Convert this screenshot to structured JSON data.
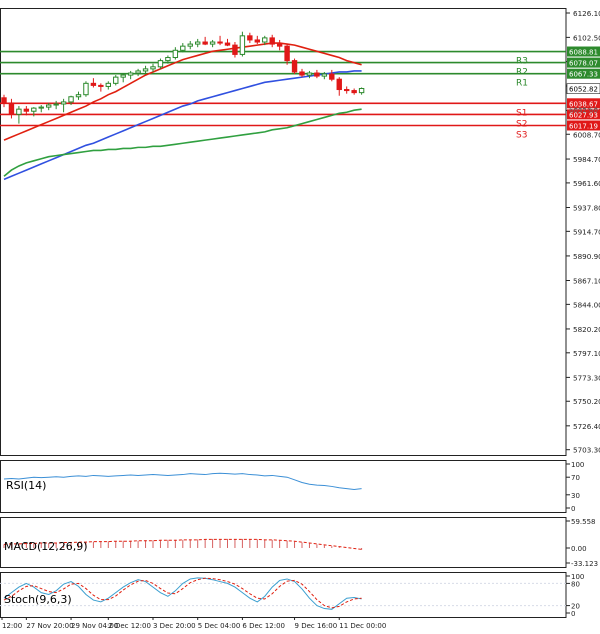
{
  "chart_data": {
    "type": "candlestick",
    "main": {
      "ylim": [
        5703.0,
        6126.1
      ],
      "y_ticks": [
        6126.1,
        6102.5,
        6079.0,
        6055.4,
        6031.8,
        6008.7,
        5984.7,
        5961.6,
        5937.8,
        5914.7,
        5890.9,
        5867.1,
        5844.0,
        5820.2,
        5797.1,
        5773.3,
        5750.2,
        5726.4,
        5703.3
      ],
      "y_tick_labels": [
        "6126.10",
        "6102.50",
        "6079.00",
        "6055.40",
        "6031.80",
        "6008.70",
        "5984.70",
        "5961.60",
        "5937.80",
        "5914.70",
        "5890.90",
        "5867.10",
        "5844.00",
        "5820.20",
        "5797.10",
        "5773.30",
        "5750.20",
        "5726.40",
        "5703.30"
      ],
      "candles": [
        {
          "o": 6044,
          "h": 6047,
          "l": 6035,
          "c": 6039
        },
        {
          "o": 6039,
          "h": 6043,
          "l": 6024,
          "c": 6028
        },
        {
          "o": 6028,
          "h": 6036,
          "l": 6019,
          "c": 6033
        },
        {
          "o": 6033,
          "h": 6036,
          "l": 6027,
          "c": 6031
        },
        {
          "o": 6031,
          "h": 6035,
          "l": 6026,
          "c": 6034
        },
        {
          "o": 6034,
          "h": 6037,
          "l": 6030,
          "c": 6035
        },
        {
          "o": 6035,
          "h": 6039,
          "l": 6032,
          "c": 6037
        },
        {
          "o": 6037,
          "h": 6041,
          "l": 6033,
          "c": 6038
        },
        {
          "o": 6038,
          "h": 6043,
          "l": 6030,
          "c": 6040
        },
        {
          "o": 6040,
          "h": 6046,
          "l": 6037,
          "c": 6045
        },
        {
          "o": 6045,
          "h": 6050,
          "l": 6042,
          "c": 6047
        },
        {
          "o": 6047,
          "h": 6060,
          "l": 6045,
          "c": 6058
        },
        {
          "o": 6058,
          "h": 6063,
          "l": 6054,
          "c": 6056
        },
        {
          "o": 6056,
          "h": 6058,
          "l": 6050,
          "c": 6055
        },
        {
          "o": 6055,
          "h": 6060,
          "l": 6052,
          "c": 6058
        },
        {
          "o": 6058,
          "h": 6066,
          "l": 6056,
          "c": 6064
        },
        {
          "o": 6064,
          "h": 6068,
          "l": 6059,
          "c": 6066
        },
        {
          "o": 6066,
          "h": 6070,
          "l": 6062,
          "c": 6068
        },
        {
          "o": 6068,
          "h": 6072,
          "l": 6065,
          "c": 6070
        },
        {
          "o": 6070,
          "h": 6075,
          "l": 6067,
          "c": 6072
        },
        {
          "o": 6072,
          "h": 6077,
          "l": 6069,
          "c": 6074
        },
        {
          "o": 6074,
          "h": 6082,
          "l": 6072,
          "c": 6080
        },
        {
          "o": 6080,
          "h": 6085,
          "l": 6077,
          "c": 6083
        },
        {
          "o": 6083,
          "h": 6093,
          "l": 6081,
          "c": 6090
        },
        {
          "o": 6090,
          "h": 6097,
          "l": 6088,
          "c": 6094
        },
        {
          "o": 6094,
          "h": 6099,
          "l": 6091,
          "c": 6096
        },
        {
          "o": 6096,
          "h": 6101,
          "l": 6093,
          "c": 6098
        },
        {
          "o": 6098,
          "h": 6103,
          "l": 6095,
          "c": 6096
        },
        {
          "o": 6096,
          "h": 6100,
          "l": 6093,
          "c": 6098
        },
        {
          "o": 6098,
          "h": 6104,
          "l": 6095,
          "c": 6097
        },
        {
          "o": 6097,
          "h": 6101,
          "l": 6094,
          "c": 6095
        },
        {
          "o": 6095,
          "h": 6098,
          "l": 6083,
          "c": 6086
        },
        {
          "o": 6086,
          "h": 6108,
          "l": 6084,
          "c": 6104
        },
        {
          "o": 6104,
          "h": 6107,
          "l": 6097,
          "c": 6100
        },
        {
          "o": 6100,
          "h": 6104,
          "l": 6096,
          "c": 6098
        },
        {
          "o": 6098,
          "h": 6104,
          "l": 6095,
          "c": 6102
        },
        {
          "o": 6102,
          "h": 6105,
          "l": 6093,
          "c": 6096
        },
        {
          "o": 6096,
          "h": 6100,
          "l": 6090,
          "c": 6094
        },
        {
          "o": 6094,
          "h": 6096,
          "l": 6076,
          "c": 6080
        },
        {
          "o": 6080,
          "h": 6082,
          "l": 6067,
          "c": 6069
        },
        {
          "o": 6069,
          "h": 6072,
          "l": 6064,
          "c": 6066
        },
        {
          "o": 6066,
          "h": 6070,
          "l": 6063,
          "c": 6068
        },
        {
          "o": 6068,
          "h": 6071,
          "l": 6063,
          "c": 6065
        },
        {
          "o": 6065,
          "h": 6069,
          "l": 6062,
          "c": 6067
        },
        {
          "o": 6067,
          "h": 6071,
          "l": 6060,
          "c": 6062
        },
        {
          "o": 6062,
          "h": 6064,
          "l": 6046,
          "c": 6052
        },
        {
          "o": 6052,
          "h": 6055,
          "l": 6048,
          "c": 6051
        },
        {
          "o": 6051,
          "h": 6053,
          "l": 6047,
          "c": 6049
        },
        {
          "o": 6049,
          "h": 6054,
          "l": 6047,
          "c": 6053
        }
      ],
      "moving_averages": [
        {
          "color": "#e02010",
          "values": [
            6003,
            6006,
            6009,
            6012,
            6015,
            6018,
            6021,
            6024,
            6027,
            6030,
            6033,
            6036,
            6040,
            6043,
            6047,
            6050,
            6054,
            6058,
            6062,
            6066,
            6069,
            6072,
            6075,
            6078,
            6081,
            6083,
            6085,
            6087,
            6089,
            6090,
            6091,
            6092,
            6093,
            6094,
            6095,
            6096,
            6097,
            6097,
            6096,
            6095,
            6093,
            6091,
            6089,
            6087,
            6085,
            6083,
            6080,
            6078,
            6076
          ]
        },
        {
          "color": "#3050e0",
          "values": [
            5965,
            5968,
            5971,
            5974,
            5977,
            5980,
            5983,
            5986,
            5989,
            5992,
            5995,
            5998,
            6000,
            6003,
            6006,
            6009,
            6012,
            6015,
            6018,
            6021,
            6024,
            6027,
            6030,
            6033,
            6036,
            6038,
            6041,
            6043,
            6045,
            6047,
            6049,
            6051,
            6053,
            6055,
            6057,
            6059,
            6060,
            6061,
            6062,
            6063,
            6064,
            6065,
            6066,
            6067,
            6068,
            6069,
            6069,
            6070,
            6070
          ]
        },
        {
          "color": "#30a040",
          "values": [
            5968,
            5974,
            5978,
            5981,
            5983,
            5985,
            5987,
            5988,
            5989,
            5990,
            5991,
            5992,
            5993,
            5993,
            5994,
            5994,
            5995,
            5995,
            5996,
            5996,
            5997,
            5997,
            5998,
            5999,
            6000,
            6001,
            6002,
            6003,
            6004,
            6005,
            6006,
            6007,
            6008,
            6009,
            6010,
            6011,
            6013,
            6014,
            6015,
            6017,
            6019,
            6021,
            6023,
            6025,
            6027,
            6029,
            6030,
            6032,
            6033
          ]
        }
      ],
      "levels": [
        {
          "name": "R3",
          "value": 6088.81,
          "label": "6088.81",
          "color": "#2d8a2d"
        },
        {
          "name": "R2",
          "value": 6078.07,
          "label": "6078.07",
          "color": "#2d8a2d"
        },
        {
          "name": "R1",
          "value": 6067.33,
          "label": "6067.33",
          "color": "#2d8a2d"
        },
        {
          "name": "S1",
          "value": 6038.67,
          "label": "6038.67",
          "color": "#e01818"
        },
        {
          "name": "S2",
          "value": 6027.93,
          "label": "6027.93",
          "color": "#e01818"
        },
        {
          "name": "S3",
          "value": 6017.19,
          "label": "6017.19",
          "color": "#e01818"
        }
      ],
      "current_price": {
        "value": 6052.82,
        "label": "6052.82"
      },
      "partial_label": "6032.60"
    },
    "rsi": {
      "title": "RSI(14)",
      "ylim": [
        0,
        100
      ],
      "ticks": [
        {
          "v": 100,
          "label": "100"
        },
        {
          "v": 70,
          "label": "70"
        },
        {
          "v": 30,
          "label": "30"
        },
        {
          "v": 0,
          "label": "0"
        }
      ],
      "values": [
        66,
        67,
        66,
        68,
        70,
        69,
        70,
        71,
        70,
        72,
        73,
        72,
        74,
        73,
        72,
        73,
        74,
        75,
        74,
        75,
        76,
        75,
        74,
        75,
        76,
        78,
        77,
        76,
        78,
        79,
        78,
        77,
        78,
        76,
        75,
        73,
        74,
        72,
        70,
        64,
        58,
        54,
        52,
        51,
        49,
        46,
        44,
        42,
        44
      ]
    },
    "macd": {
      "title": "MACD(12,26,9)",
      "ylim": [
        -33.123,
        59.558
      ],
      "ticks": [
        {
          "v": 59.558,
          "label": "59.558"
        },
        {
          "v": 0.0,
          "label": "0.00"
        },
        {
          "v": -33.123,
          "label": "-33.123"
        }
      ],
      "histogram": [
        8,
        9,
        9,
        10,
        10,
        11,
        11,
        12,
        12,
        13,
        13,
        14,
        14,
        15,
        15,
        15,
        16,
        16,
        16,
        17,
        17,
        17,
        18,
        18,
        18,
        19,
        19,
        19,
        20,
        20,
        20,
        20,
        20,
        20,
        19,
        19,
        18,
        17,
        16,
        14,
        12,
        10,
        8,
        6,
        4,
        2,
        0,
        -2,
        -4
      ],
      "signal": [
        8,
        9,
        9,
        10,
        10,
        11,
        11,
        11,
        12,
        12,
        13,
        13,
        14,
        14,
        14,
        15,
        15,
        15,
        16,
        16,
        16,
        17,
        17,
        17,
        18,
        18,
        18,
        19,
        19,
        19,
        19,
        19,
        19,
        19,
        19,
        18,
        18,
        17,
        16,
        15,
        13,
        11,
        9,
        7,
        5,
        3,
        1,
        -1,
        -3
      ]
    },
    "stoch": {
      "title": "Stoch(9,6,3)",
      "ylim": [
        0,
        100
      ],
      "ticks": [
        {
          "v": 100,
          "label": "100"
        },
        {
          "v": 80,
          "label": "80"
        },
        {
          "v": 20,
          "label": "20"
        },
        {
          "v": 0,
          "label": "0"
        }
      ],
      "main": [
        40,
        55,
        70,
        80,
        70,
        55,
        50,
        60,
        78,
        85,
        72,
        50,
        35,
        30,
        40,
        55,
        70,
        82,
        90,
        85,
        70,
        55,
        45,
        60,
        80,
        92,
        95,
        94,
        90,
        85,
        80,
        70,
        55,
        40,
        30,
        45,
        70,
        88,
        92,
        85,
        65,
        40,
        20,
        12,
        10,
        25,
        40,
        42,
        38
      ],
      "signal": [
        35,
        45,
        60,
        72,
        74,
        66,
        58,
        55,
        65,
        78,
        80,
        66,
        48,
        36,
        36,
        46,
        62,
        76,
        86,
        88,
        80,
        66,
        54,
        52,
        66,
        82,
        90,
        94,
        93,
        90,
        85,
        78,
        66,
        52,
        40,
        38,
        52,
        72,
        86,
        88,
        78,
        58,
        36,
        20,
        14,
        18,
        30,
        38,
        40
      ]
    },
    "x_tick_labels": [
      {
        "i": -3,
        "label": "12:00"
      },
      {
        "i": 3,
        "label": "27 Nov 20:00"
      },
      {
        "i": 9,
        "label": "29 Nov 04:00"
      },
      {
        "i": 14,
        "label": "2 Dec 12:00"
      },
      {
        "i": 20,
        "label": "3 Dec 20:00"
      },
      {
        "i": 26,
        "label": "5 Dec 04:00"
      },
      {
        "i": 32,
        "label": "6 Dec 12:00"
      },
      {
        "i": 39,
        "label": "9 Dec 16:00"
      },
      {
        "i": 45,
        "label": "11 Dec 00:00"
      }
    ],
    "colors": {
      "bull": "#2d8a2d",
      "bear": "#e01818",
      "rsi": "#3b8fd6",
      "macd_hist": "#d66060",
      "macd_signal": "#e02010",
      "stoch_main": "#3b9fd0",
      "stoch_signal": "#e02010",
      "grid": "#d8dce8"
    }
  }
}
